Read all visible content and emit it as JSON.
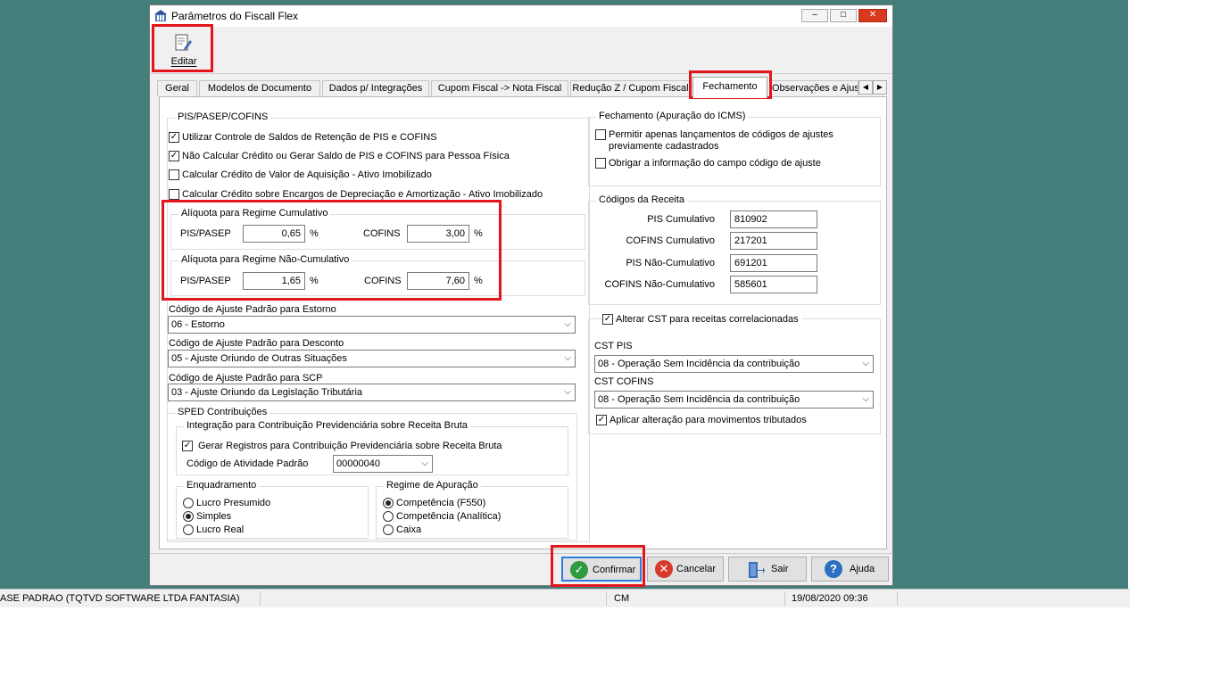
{
  "window": {
    "title": "Parâmetros do Fiscall Flex",
    "toolbar": {
      "edit_label": "Editar"
    }
  },
  "tabs": [
    "Geral",
    "Modelos de Documento",
    "Dados p/ Integrações",
    "Cupom Fiscal -> Nota Fiscal",
    "Redução Z / Cupom Fiscal",
    "Fechamento",
    "Observações e Ajustes"
  ],
  "active_tab": "Fechamento",
  "pis_cofins": {
    "title": "PIS/PASEP/COFINS",
    "options": [
      {
        "label": "Utilizar Controle de Saldos de Retenção de PIS e COFINS",
        "checked": true
      },
      {
        "label": "Não Calcular Crédito ou Gerar Saldo de PIS e COFINS para Pessoa Física",
        "checked": true
      },
      {
        "label": "Calcular Crédito de Valor de Aquisição - Ativo Imobilizado",
        "checked": false
      },
      {
        "label": "Calcular Crédito sobre Encargos de Depreciação e Amortização - Ativo Imobilizado",
        "checked": false
      }
    ],
    "cumulativo": {
      "title": "Alíquota para Regime Cumulativo",
      "pis_label": "PIS/PASEP",
      "pis_value": "0,65",
      "cofins_label": "COFINS",
      "cofins_value": "3,00",
      "unit": "%"
    },
    "nao_cumulativo": {
      "title": "Alíquota para Regime Não-Cumulativo",
      "pis_label": "PIS/PASEP",
      "pis_value": "1,65",
      "cofins_label": "COFINS",
      "cofins_value": "7,60",
      "unit": "%"
    }
  },
  "ajuste": {
    "estorno_label": "Código de Ajuste Padrão para Estorno",
    "estorno_value": "06 - Estorno",
    "desconto_label": "Código de Ajuste Padrão para Desconto",
    "desconto_value": "05 - Ajuste Oriundo de Outras Situações",
    "scp_label": "Código de Ajuste Padrão para SCP",
    "scp_value": "03 - Ajuste Oriundo da Legislação Tributária"
  },
  "sped": {
    "title": "SPED Contribuições",
    "integracao_title": "Integração para Contribuição Previdenciária sobre Receita Bruta",
    "gerar_label": "Gerar Registros para Contribuição Previdenciária sobre Receita Bruta",
    "atividade_label": "Código de Atividade Padrão",
    "atividade_value": "00000040",
    "enquadramento": {
      "title": "Enquadramento",
      "options": [
        "Lucro Presumido",
        "Simples",
        "Lucro Real"
      ],
      "selected": "Simples"
    },
    "regime": {
      "title": "Regime de Apuração",
      "options": [
        "Competência (F550)",
        "Competência (Analítica)",
        "Caixa"
      ],
      "selected": "Competência (F550)"
    }
  },
  "fechamento": {
    "title": "Fechamento (Apuração do ICMS)",
    "opt1_line1": "Permitir apenas lançamentos de códigos de ajustes",
    "opt1_line2": "previamente cadastrados",
    "opt2": "Obrigar a informação do campo código de ajuste"
  },
  "receita": {
    "title": "Códigos da Receita",
    "rows": [
      {
        "label": "PIS Cumulativo",
        "value": "810902"
      },
      {
        "label": "COFINS Cumulativo",
        "value": "217201"
      },
      {
        "label": "PIS Não-Cumulativo",
        "value": "691201"
      },
      {
        "label": "COFINS Não-Cumulativo",
        "value": "585601"
      }
    ]
  },
  "cst": {
    "alterar_label": "Alterar CST para receitas correlacionadas",
    "pis_label": "CST PIS",
    "pis_value": "08 - Operação Sem Incidência da contribuição",
    "cofins_label": "CST COFINS",
    "cofins_value": "08 - Operação Sem Incidência da contribuição",
    "aplicar_label": "Aplicar alteração para movimentos tributados"
  },
  "buttons": {
    "confirmar": "Confirmar",
    "cancelar": "Cancelar",
    "sair": "Sair",
    "ajuda": "Ajuda"
  },
  "statusbar": {
    "company": "ASE PADRAO (TQTVD SOFTWARE LTDA FANTASIA)",
    "mode": "CM",
    "datetime": "19/08/2020 09:36"
  },
  "colors": {
    "desktop": "#437e7b",
    "highlight": "#e3151d",
    "confirm": "#2e9b3e",
    "cancel": "#d63a2c",
    "help": "#2c6fc2"
  }
}
